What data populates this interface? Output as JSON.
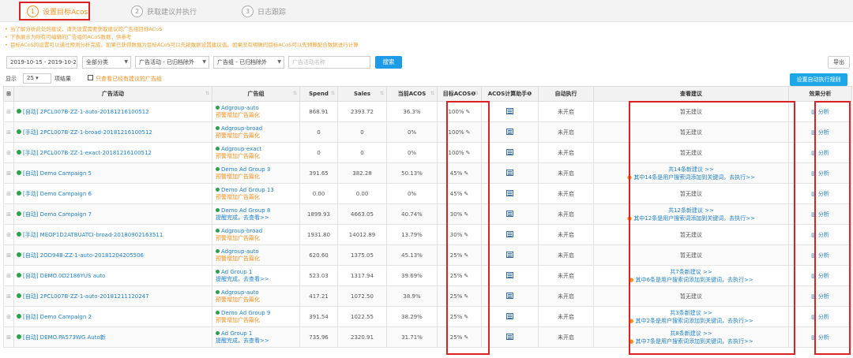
{
  "steps": [
    {
      "num": "1",
      "label": "设置目标Acos"
    },
    {
      "num": "2",
      "label": "获取建议并执行"
    },
    {
      "num": "3",
      "label": "日志跟踪"
    }
  ],
  "notes": [
    "当了解分析此处的建议，请先设置需要获取建议的广告组目标ACoS",
    "下表展示为所有可编辑的广告组的ACoS数据，供参考",
    "目标ACoS的设置可以通过预测分析完成，如果已获得数据为目标ACoS可以先按数据设置建议值，如果没有明确的目标ACoS可以先预算配合数据进行计算"
  ],
  "filters": {
    "date_range": "2019-10-15 - 2019-10-2",
    "category": "全部分类",
    "campaign_status": "广告活动 - 已归档除外",
    "group_status": "广告组 - 已归档除外",
    "search_placeholder": "广告活动名称",
    "search_button": "搜索",
    "export_button": "导出"
  },
  "options": {
    "show_label": "显示",
    "page_size": "25",
    "page_size_suffix": "项结果",
    "only_suggestions": "只查看已经有建议的广告组",
    "auto_button": "设置自动执行规则"
  },
  "columns": [
    "广告活动",
    "广告组",
    "Spend",
    "Sales",
    "当前ACOS",
    "目标ACOS",
    "ACOS计算助手",
    "自动执行",
    "查看建议",
    "效果分析"
  ],
  "icons": {
    "pencil": "pencil-icon",
    "calculator": "calculator-icon",
    "chart": "bar-chart-icon",
    "warning": "warning-icon"
  },
  "rows": [
    {
      "campaign": "[自动] 2PCL007B-ZZ-1-auto-20181216100512",
      "group": "Adgroup-auto",
      "group_sub": "预警增加广告篇化",
      "spend": "868.91",
      "sales": "2393.72",
      "acos": "36.3%",
      "target": "100%",
      "auto": "未开启",
      "sugg_main": "暂无建议",
      "sugg_extra": "",
      "analysis": "分析"
    },
    {
      "campaign": "[手动] 2PCL007B-ZZ-1-broad-20181216100512",
      "group": "Adgroup-broad",
      "group_sub": "预警增加广告篇化",
      "spend": "0",
      "sales": "0",
      "acos": "0%",
      "target": "100%",
      "auto": "未开启",
      "sugg_main": "暂无建议",
      "sugg_extra": "",
      "analysis": "分析"
    },
    {
      "campaign": "[手动] 2PCL007B-ZZ-1-exact-20181216100512",
      "group": "Adgroup-exact",
      "group_sub": "预警增加广告篇化",
      "spend": "0",
      "sales": "0",
      "acos": "0%",
      "target": "100%",
      "auto": "未开启",
      "sugg_main": "暂无建议",
      "sugg_extra": "",
      "analysis": "分析"
    },
    {
      "campaign": "[自动] Demo Campaign 5",
      "group": "Demo Ad Group 3",
      "group_sub": "预警增加广告篇化",
      "spend": "391.65",
      "sales": "382.28",
      "acos": "50.13%",
      "target": "45%",
      "auto": "未开启",
      "sugg_main": "共14条新建议 >>",
      "sugg_extra": "其中14条是用户搜索词添加到关键词，去执行>>",
      "analysis": "分析"
    },
    {
      "campaign": "[手动] Demo Campaign 6",
      "group": "Demo Ad Group 13",
      "group_sub": "预警增加广告篇化",
      "spend": "0.00",
      "sales": "0.00",
      "acos": "0%",
      "target": "45%",
      "auto": "未开启",
      "sugg_main": "暂无建议",
      "sugg_extra": "",
      "analysis": "分析"
    },
    {
      "campaign": "[自动] Demo Campaign 7",
      "group": "Demo Ad Group 8",
      "group_sub": "提醒完成，去查看>>",
      "spend": "1899.93",
      "sales": "4663.05",
      "acos": "40.74%",
      "target": "30%",
      "auto": "未开启",
      "sugg_main": "共12条新建议 >>",
      "sugg_extra": "其中12条是用户搜索词添加到关键词，去执行>>",
      "analysis": "分析"
    },
    {
      "campaign": "[手动] MEOP1D2ATBUATCI-broad-20180902163511",
      "group": "Adgroup-broad",
      "group_sub": "预警增加广告篇化",
      "spend": "1931.80",
      "sales": "14012.89",
      "acos": "13.79%",
      "target": "30%",
      "auto": "未开启",
      "sugg_main": "暂无建议",
      "sugg_extra": "",
      "analysis": "分析"
    },
    {
      "campaign": "[自动] 2OD94B-ZZ-1-auto-20181204205506",
      "group": "Adgroup-auto",
      "group_sub": "预警增加广告篇化",
      "spend": "620.60",
      "sales": "1375.05",
      "acos": "45.13%",
      "target": "25%",
      "auto": "未开启",
      "sugg_main": "暂无建议",
      "sugg_extra": "",
      "analysis": "分析"
    },
    {
      "campaign": "[自动] DEMO.0D2186YUS auto",
      "group": "Ad Group 1",
      "group_sub": "提醒完成，去查看>>",
      "spend": "523.03",
      "sales": "1317.94",
      "acos": "39.69%",
      "target": "25%",
      "auto": "未开启",
      "sugg_main": "共7条新建议 >>",
      "sugg_extra": "其中6条是用户搜索词添加到关键词，去执行>>",
      "analysis": "分析"
    },
    {
      "campaign": "[自动] 2PCL007B-ZZ-1-auto-20181211120247",
      "group": "Adgroup-auto",
      "group_sub": "预警增加广告篇化",
      "spend": "417.21",
      "sales": "1072.50",
      "acos": "38.9%",
      "target": "25%",
      "auto": "未开启",
      "sugg_main": "暂无建议",
      "sugg_extra": "",
      "analysis": "分析"
    },
    {
      "campaign": "[自动] Demo Campaign 2",
      "group": "Demo Ad Group 9",
      "group_sub": "预警增加广告篇化",
      "spend": "391.54",
      "sales": "1022.55",
      "acos": "38.29%",
      "target": "25%",
      "auto": "未开启",
      "sugg_main": "共3条新建议 >>",
      "sugg_extra": "其中2条是用户搜索词添加到关键词，去执行>>",
      "analysis": "分析"
    },
    {
      "campaign": "[自动] DEMO.PA573WG Auto新",
      "group": "Ad Group 1",
      "group_sub": "提醒完成，去查看>>",
      "spend": "735.96",
      "sales": "2320.91",
      "acos": "31.71%",
      "target": "25%",
      "auto": "未开启",
      "sugg_main": "共8条新建议 >>",
      "sugg_extra": "其中7条是用户搜索词添加到关键词，去执行>>",
      "analysis": "分析"
    }
  ]
}
